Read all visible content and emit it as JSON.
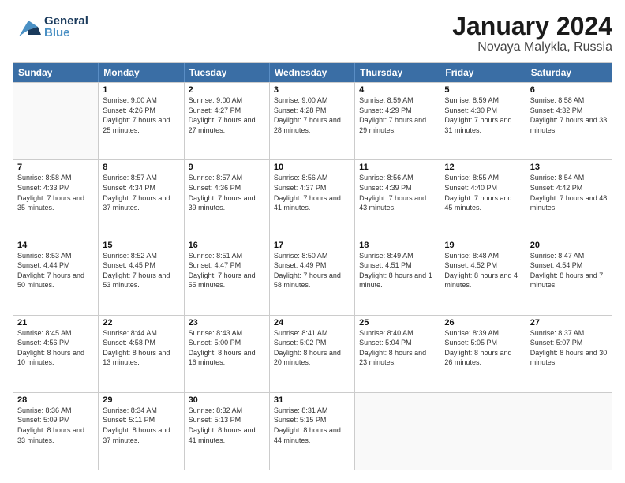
{
  "header": {
    "logo_general": "General",
    "logo_blue": "Blue",
    "month": "January 2024",
    "location": "Novaya Malykla, Russia"
  },
  "days_of_week": [
    "Sunday",
    "Monday",
    "Tuesday",
    "Wednesday",
    "Thursday",
    "Friday",
    "Saturday"
  ],
  "weeks": [
    [
      {
        "day": "",
        "sunrise": "",
        "sunset": "",
        "daylight": ""
      },
      {
        "day": "1",
        "sunrise": "Sunrise: 9:00 AM",
        "sunset": "Sunset: 4:26 PM",
        "daylight": "Daylight: 7 hours and 25 minutes."
      },
      {
        "day": "2",
        "sunrise": "Sunrise: 9:00 AM",
        "sunset": "Sunset: 4:27 PM",
        "daylight": "Daylight: 7 hours and 27 minutes."
      },
      {
        "day": "3",
        "sunrise": "Sunrise: 9:00 AM",
        "sunset": "Sunset: 4:28 PM",
        "daylight": "Daylight: 7 hours and 28 minutes."
      },
      {
        "day": "4",
        "sunrise": "Sunrise: 8:59 AM",
        "sunset": "Sunset: 4:29 PM",
        "daylight": "Daylight: 7 hours and 29 minutes."
      },
      {
        "day": "5",
        "sunrise": "Sunrise: 8:59 AM",
        "sunset": "Sunset: 4:30 PM",
        "daylight": "Daylight: 7 hours and 31 minutes."
      },
      {
        "day": "6",
        "sunrise": "Sunrise: 8:58 AM",
        "sunset": "Sunset: 4:32 PM",
        "daylight": "Daylight: 7 hours and 33 minutes."
      }
    ],
    [
      {
        "day": "7",
        "sunrise": "Sunrise: 8:58 AM",
        "sunset": "Sunset: 4:33 PM",
        "daylight": "Daylight: 7 hours and 35 minutes."
      },
      {
        "day": "8",
        "sunrise": "Sunrise: 8:57 AM",
        "sunset": "Sunset: 4:34 PM",
        "daylight": "Daylight: 7 hours and 37 minutes."
      },
      {
        "day": "9",
        "sunrise": "Sunrise: 8:57 AM",
        "sunset": "Sunset: 4:36 PM",
        "daylight": "Daylight: 7 hours and 39 minutes."
      },
      {
        "day": "10",
        "sunrise": "Sunrise: 8:56 AM",
        "sunset": "Sunset: 4:37 PM",
        "daylight": "Daylight: 7 hours and 41 minutes."
      },
      {
        "day": "11",
        "sunrise": "Sunrise: 8:56 AM",
        "sunset": "Sunset: 4:39 PM",
        "daylight": "Daylight: 7 hours and 43 minutes."
      },
      {
        "day": "12",
        "sunrise": "Sunrise: 8:55 AM",
        "sunset": "Sunset: 4:40 PM",
        "daylight": "Daylight: 7 hours and 45 minutes."
      },
      {
        "day": "13",
        "sunrise": "Sunrise: 8:54 AM",
        "sunset": "Sunset: 4:42 PM",
        "daylight": "Daylight: 7 hours and 48 minutes."
      }
    ],
    [
      {
        "day": "14",
        "sunrise": "Sunrise: 8:53 AM",
        "sunset": "Sunset: 4:44 PM",
        "daylight": "Daylight: 7 hours and 50 minutes."
      },
      {
        "day": "15",
        "sunrise": "Sunrise: 8:52 AM",
        "sunset": "Sunset: 4:45 PM",
        "daylight": "Daylight: 7 hours and 53 minutes."
      },
      {
        "day": "16",
        "sunrise": "Sunrise: 8:51 AM",
        "sunset": "Sunset: 4:47 PM",
        "daylight": "Daylight: 7 hours and 55 minutes."
      },
      {
        "day": "17",
        "sunrise": "Sunrise: 8:50 AM",
        "sunset": "Sunset: 4:49 PM",
        "daylight": "Daylight: 7 hours and 58 minutes."
      },
      {
        "day": "18",
        "sunrise": "Sunrise: 8:49 AM",
        "sunset": "Sunset: 4:51 PM",
        "daylight": "Daylight: 8 hours and 1 minute."
      },
      {
        "day": "19",
        "sunrise": "Sunrise: 8:48 AM",
        "sunset": "Sunset: 4:52 PM",
        "daylight": "Daylight: 8 hours and 4 minutes."
      },
      {
        "day": "20",
        "sunrise": "Sunrise: 8:47 AM",
        "sunset": "Sunset: 4:54 PM",
        "daylight": "Daylight: 8 hours and 7 minutes."
      }
    ],
    [
      {
        "day": "21",
        "sunrise": "Sunrise: 8:45 AM",
        "sunset": "Sunset: 4:56 PM",
        "daylight": "Daylight: 8 hours and 10 minutes."
      },
      {
        "day": "22",
        "sunrise": "Sunrise: 8:44 AM",
        "sunset": "Sunset: 4:58 PM",
        "daylight": "Daylight: 8 hours and 13 minutes."
      },
      {
        "day": "23",
        "sunrise": "Sunrise: 8:43 AM",
        "sunset": "Sunset: 5:00 PM",
        "daylight": "Daylight: 8 hours and 16 minutes."
      },
      {
        "day": "24",
        "sunrise": "Sunrise: 8:41 AM",
        "sunset": "Sunset: 5:02 PM",
        "daylight": "Daylight: 8 hours and 20 minutes."
      },
      {
        "day": "25",
        "sunrise": "Sunrise: 8:40 AM",
        "sunset": "Sunset: 5:04 PM",
        "daylight": "Daylight: 8 hours and 23 minutes."
      },
      {
        "day": "26",
        "sunrise": "Sunrise: 8:39 AM",
        "sunset": "Sunset: 5:05 PM",
        "daylight": "Daylight: 8 hours and 26 minutes."
      },
      {
        "day": "27",
        "sunrise": "Sunrise: 8:37 AM",
        "sunset": "Sunset: 5:07 PM",
        "daylight": "Daylight: 8 hours and 30 minutes."
      }
    ],
    [
      {
        "day": "28",
        "sunrise": "Sunrise: 8:36 AM",
        "sunset": "Sunset: 5:09 PM",
        "daylight": "Daylight: 8 hours and 33 minutes."
      },
      {
        "day": "29",
        "sunrise": "Sunrise: 8:34 AM",
        "sunset": "Sunset: 5:11 PM",
        "daylight": "Daylight: 8 hours and 37 minutes."
      },
      {
        "day": "30",
        "sunrise": "Sunrise: 8:32 AM",
        "sunset": "Sunset: 5:13 PM",
        "daylight": "Daylight: 8 hours and 41 minutes."
      },
      {
        "day": "31",
        "sunrise": "Sunrise: 8:31 AM",
        "sunset": "Sunset: 5:15 PM",
        "daylight": "Daylight: 8 hours and 44 minutes."
      },
      {
        "day": "",
        "sunrise": "",
        "sunset": "",
        "daylight": ""
      },
      {
        "day": "",
        "sunrise": "",
        "sunset": "",
        "daylight": ""
      },
      {
        "day": "",
        "sunrise": "",
        "sunset": "",
        "daylight": ""
      }
    ]
  ]
}
